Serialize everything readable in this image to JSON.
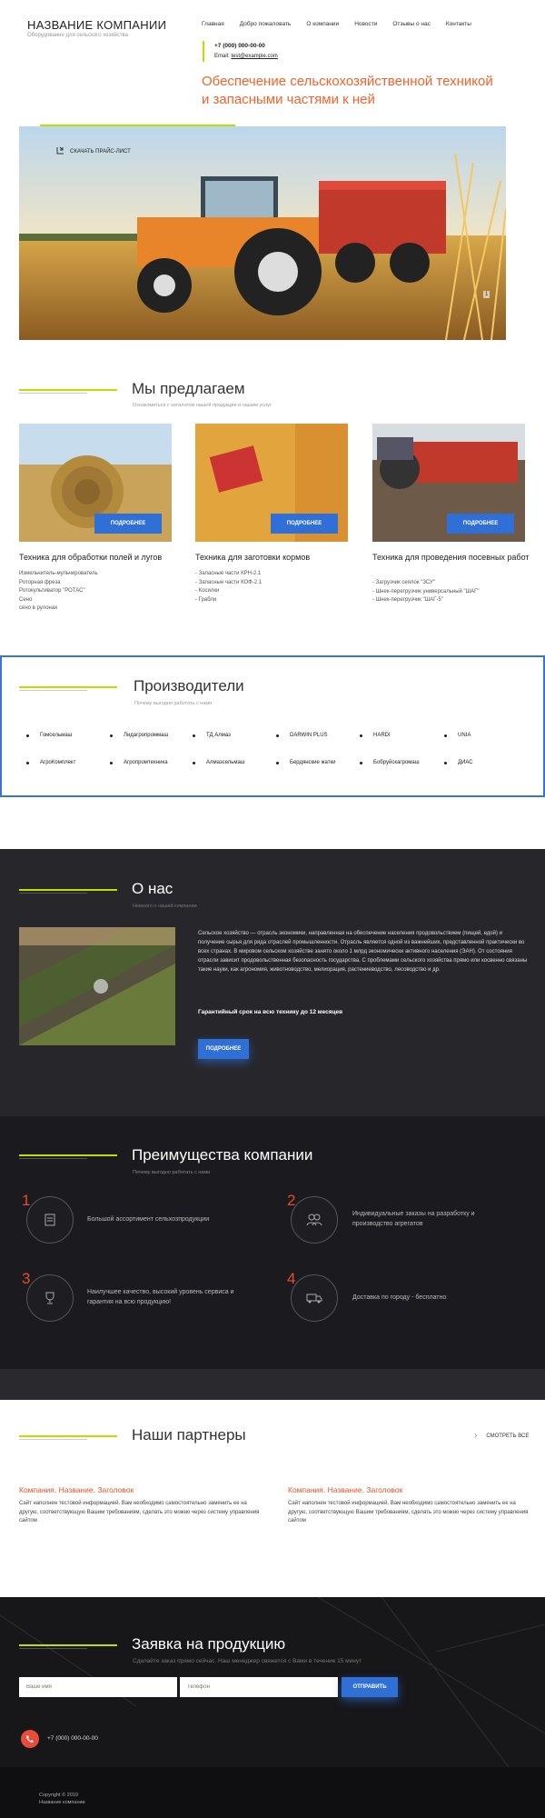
{
  "header": {
    "company_name": "НАЗВАНИЕ КОМПАНИИ",
    "company_tagline": "Оборудование для сельского хозяйства",
    "nav": [
      "Главная",
      "Добро пожаловать",
      "О компании",
      "Новости",
      "Отзывы о нас",
      "Контакты"
    ],
    "phone": "+7 (000) 000-00-00",
    "email_label": "Email:",
    "email": "test@example.com",
    "headline": "Обеспечение сельскохозяйственной техникой и запасными частями к ней"
  },
  "hero": {
    "price_link": "СКАЧАТЬ ПРАЙС-ЛИСТ",
    "slide_number": "1"
  },
  "offer": {
    "title": "Мы предлагаем",
    "subtitle": "Ознакомиться с каталогом нашей продукции и нашим услуг",
    "button_label": "ПОДРОБНЕЕ",
    "cards": [
      {
        "title": "Техника для обработки полей и лугов",
        "items": [
          "Измельчитель-мульчирователь",
          "Роторная фреза",
          "Ротокультиватор \"РОТАС\"",
          "Сено",
          "сено в рулонах"
        ]
      },
      {
        "title": "Техника для заготовки кормов",
        "items": [
          "- Запасные части КРН-2.1",
          "- Запасные части КОФ-2.1",
          "- Косилки",
          "- Грабли"
        ]
      },
      {
        "title": "Техника для проведения посевных работ",
        "items": [
          "- Загрузчик сеялок \"ЗСУ\"",
          "- Шнек-перегрузчик универсальный \"ШАГ\"",
          "- Шнек-перегрузчик \"ШАГ-5\""
        ]
      }
    ]
  },
  "producers": {
    "title": "Производители",
    "subtitle": "Почему выгодно работать с нами",
    "row1": [
      "Гомсельмаш",
      "Лидагропроммаш",
      "ТД Алмаз",
      "DARWIN PLUS",
      "HARDI",
      "UNIA"
    ],
    "row2": [
      "АгроКомплект",
      "Агропромтехника",
      "Алмазсельмаш",
      "Бердянские жатки",
      "Бобруйскагромаш",
      "ДИАС"
    ]
  },
  "about": {
    "title": "О нас",
    "subtitle": "Немного о нашей компании",
    "text": "Сельское хозяйство — отрасль экономики, направленная на обеспечение населения продовольствием (пищей, едой) и получение сырья для ряда отраслей промышленности. Отрасль является одной из важнейших, представленной практически во всех странах. В мировом сельском хозяйстве занято около 1 млрд экономически активного населения (ЭАН). От состояния отрасли зависит продовольственная безопасность государства. С проблемами сельского хозяйства прямо или косвенно связаны такие науки, как агрономия, животноводство, мелиорация, растениеводство, лесоводство и др.",
    "guarantee": "Гарантийный срок на всю технику до 12 месяцев",
    "button_label": "ПОДРОБНЕЕ"
  },
  "advantages": {
    "title": "Преимущества компании",
    "subtitle": "Почему выгодно работать с нами",
    "items": [
      {
        "num": "1",
        "text": "Большой ассортимент сельхозпродукции",
        "icon": "catalog-icon"
      },
      {
        "num": "2",
        "text": "Индивидуальные заказы на разработку и производство агрегатов",
        "icon": "people-icon"
      },
      {
        "num": "3",
        "text": "Наилучшее качество, высокий уровень сервиса и гарантия на всю продукцию!",
        "icon": "trophy-icon"
      },
      {
        "num": "4",
        "text": "Доставка по городу - бесплатно",
        "icon": "truck-icon"
      }
    ]
  },
  "partners": {
    "title": "Наши партнеры",
    "view_all": "СМОТРЕТЬ ВСЕ",
    "items": [
      {
        "title": "Компания. Название. Заголовок",
        "text": "Сайт наполнен тестовой информацией. Вам необходимо самостоятельно заменить ее на другую, соответствующую Вашим требованиям, сделать это можно через систему управления сайтом"
      },
      {
        "title": "Компания. Название. Заголовок",
        "text": "Сайт наполнен тестовой информацией. Вам необходимо самостоятельно заменить ее на другую, соответствующую Вашим требованиям, сделать это можно через систему управления сайтом"
      }
    ]
  },
  "request": {
    "title": "Заявка на продукцию",
    "subtitle": "Сделайте заказ прямо сейчас. Наш менеджер свяжется с Вами в течение 15 минут",
    "name_placeholder": "Ваше имя",
    "phone_placeholder": "Телефон",
    "submit": "ОТПРАВИТЬ",
    "phone": "+7 (000) 000-00-00"
  },
  "footer": {
    "copyright": "Copyright © 2019",
    "company": "Название компании"
  },
  "colors": {
    "accent_green": "#b8e000",
    "accent_orange": "#f0642d",
    "button_blue": "#2f6fd6",
    "dark_bg": "#27272b"
  }
}
